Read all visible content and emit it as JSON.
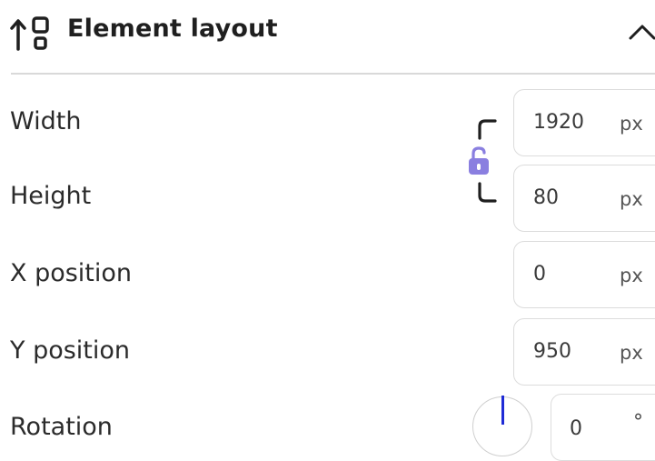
{
  "header": {
    "title": "Element layout",
    "icon": "layout-align-icon",
    "collapse_icon": "chevron-up-icon"
  },
  "width": {
    "label": "Width",
    "value": "1920",
    "unit": "px"
  },
  "height": {
    "label": "Height",
    "value": "80",
    "unit": "px"
  },
  "x_position": {
    "label": "X position",
    "value": "0",
    "unit": "px"
  },
  "y_position": {
    "label": "Y position",
    "value": "950",
    "unit": "px"
  },
  "rotation": {
    "label": "Rotation",
    "value": "0",
    "unit": "°"
  },
  "lock": {
    "icon": "unlock-icon",
    "state": "unlocked",
    "color": "#8a7fe0"
  },
  "colors": {
    "dial_needle": "#1f2bd6",
    "divider": "#d9d9d9"
  }
}
